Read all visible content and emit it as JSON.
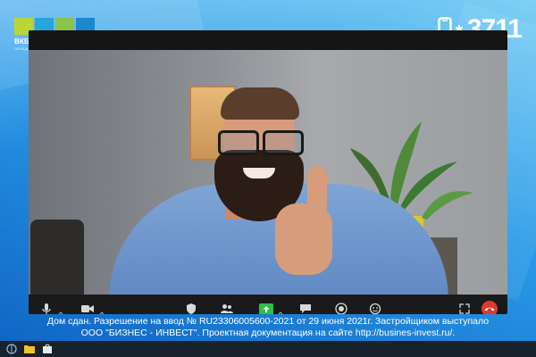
{
  "logo": {
    "name": "ВКБ-НОВОСТРОЙКИ",
    "subtitle": "ОБЪЕДИНЕНИЕ ЗАСТРОЙЩИКОВ ВКБ",
    "block_colors": [
      "#b9d637",
      "#27a6dc",
      "#8bc34a",
      "#1d87d0"
    ]
  },
  "phone": {
    "icon": "phone-icon",
    "number": "3711"
  },
  "video_call": {
    "toolbar_icons": [
      "microphone-icon",
      "video-camera-icon",
      "shield-icon",
      "participants-icon",
      "share-screen-icon",
      "chat-icon",
      "record-icon",
      "reactions-icon",
      "fullscreen-icon",
      "end-call-icon"
    ],
    "share_color": "#2fbe4a",
    "end_call_color": "#e03a2e"
  },
  "caption": {
    "line1": "Дом сдан. Разрешение на ввод № RU23306005600-2021 от 29 июня 2021г. Застройщиком выступало",
    "line2": "ООО \"БИЗНЕС - ИНВЕСТ\". Проектная документация на сайте http://busines-invest.ru/."
  },
  "taskbar": {
    "icons": [
      "windows-start-icon",
      "file-explorer-icon",
      "store-icon"
    ]
  }
}
